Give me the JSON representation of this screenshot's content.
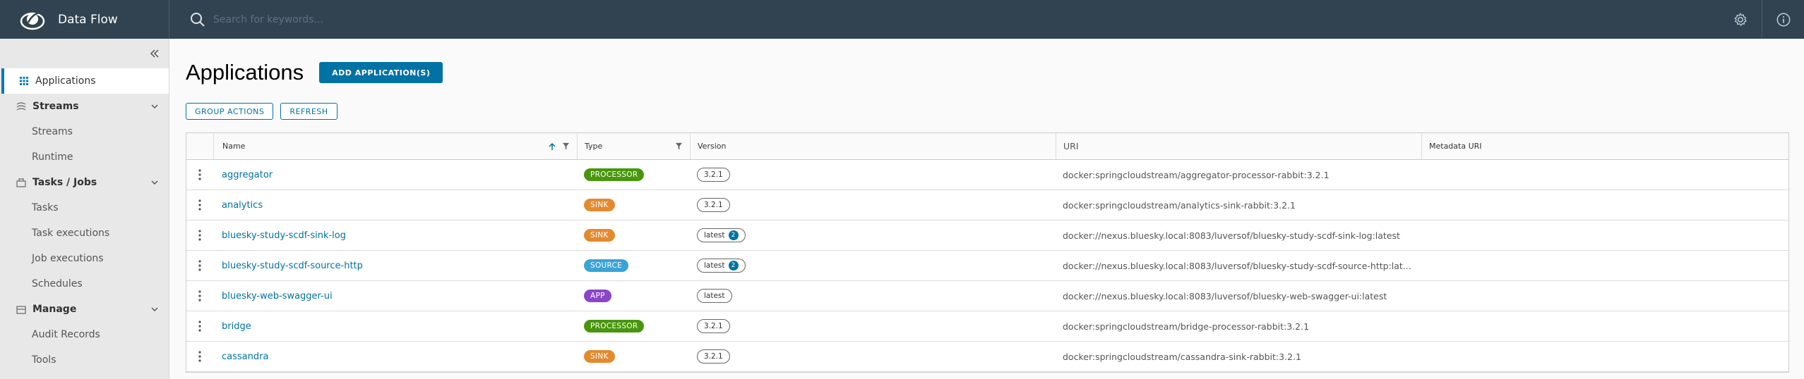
{
  "header": {
    "app_name": "Data Flow",
    "search_placeholder": "Search for keywords...",
    "icons": [
      "spring-logo-icon",
      "search-icon",
      "gear-icon",
      "info-icon"
    ]
  },
  "sidebar": {
    "collapse_icon": "double-chevron-left-icon",
    "items": [
      {
        "label": "Applications",
        "kind": "top",
        "active": true,
        "icon": "grid-icon"
      },
      {
        "label": "Streams",
        "kind": "group",
        "icon": "streams-icon"
      },
      {
        "label": "Streams",
        "kind": "sub"
      },
      {
        "label": "Runtime",
        "kind": "sub"
      },
      {
        "label": "Tasks / Jobs",
        "kind": "group",
        "icon": "tasks-icon"
      },
      {
        "label": "Tasks",
        "kind": "sub"
      },
      {
        "label": "Task executions",
        "kind": "sub"
      },
      {
        "label": "Job executions",
        "kind": "sub"
      },
      {
        "label": "Schedules",
        "kind": "sub"
      },
      {
        "label": "Manage",
        "kind": "group",
        "icon": "manage-icon"
      },
      {
        "label": "Audit Records",
        "kind": "sub"
      },
      {
        "label": "Tools",
        "kind": "sub"
      }
    ]
  },
  "main": {
    "title": "Applications",
    "add_button": "ADD APPLICATION(S)",
    "group_actions": "GROUP ACTIONS",
    "refresh": "REFRESH"
  },
  "table": {
    "columns": {
      "name": "Name",
      "type": "Type",
      "version": "Version",
      "uri": "URI",
      "metadata_uri": "Metadata URI"
    },
    "rows": [
      {
        "name": "aggregator",
        "type": "PROCESSOR",
        "version": "3.2.1",
        "versions_count": "",
        "uri": "docker:springcloudstream/aggregator-processor-rabbit:3.2.1",
        "metadata_uri": ""
      },
      {
        "name": "analytics",
        "type": "SINK",
        "version": "3.2.1",
        "versions_count": "",
        "uri": "docker:springcloudstream/analytics-sink-rabbit:3.2.1",
        "metadata_uri": ""
      },
      {
        "name": "bluesky-study-scdf-sink-log",
        "type": "SINK",
        "version": "latest",
        "versions_count": "2",
        "uri": "docker://nexus.bluesky.local:8083/luversof/bluesky-study-scdf-sink-log:latest",
        "metadata_uri": ""
      },
      {
        "name": "bluesky-study-scdf-source-http",
        "type": "SOURCE",
        "version": "latest",
        "versions_count": "2",
        "uri": "docker://nexus.bluesky.local:8083/luversof/bluesky-study-scdf-source-http:lat...",
        "metadata_uri": ""
      },
      {
        "name": "bluesky-web-swagger-ui",
        "type": "APP",
        "version": "latest",
        "versions_count": "",
        "uri": "docker://nexus.bluesky.local:8083/luversof/bluesky-web-swagger-ui:latest",
        "metadata_uri": ""
      },
      {
        "name": "bridge",
        "type": "PROCESSOR",
        "version": "3.2.1",
        "versions_count": "",
        "uri": "docker:springcloudstream/bridge-processor-rabbit:3.2.1",
        "metadata_uri": ""
      },
      {
        "name": "cassandra",
        "type": "SINK",
        "version": "3.2.1",
        "versions_count": "",
        "uri": "docker:springcloudstream/cassandra-sink-rabbit:3.2.1",
        "metadata_uri": ""
      }
    ]
  },
  "colors": {
    "header_bg": "#314351",
    "PROCESSOR": "#48960c",
    "SINK": "#e38a2e",
    "SOURCE": "#3ba3d6",
    "APP": "#8a46c7",
    "link": "#0072a3"
  }
}
